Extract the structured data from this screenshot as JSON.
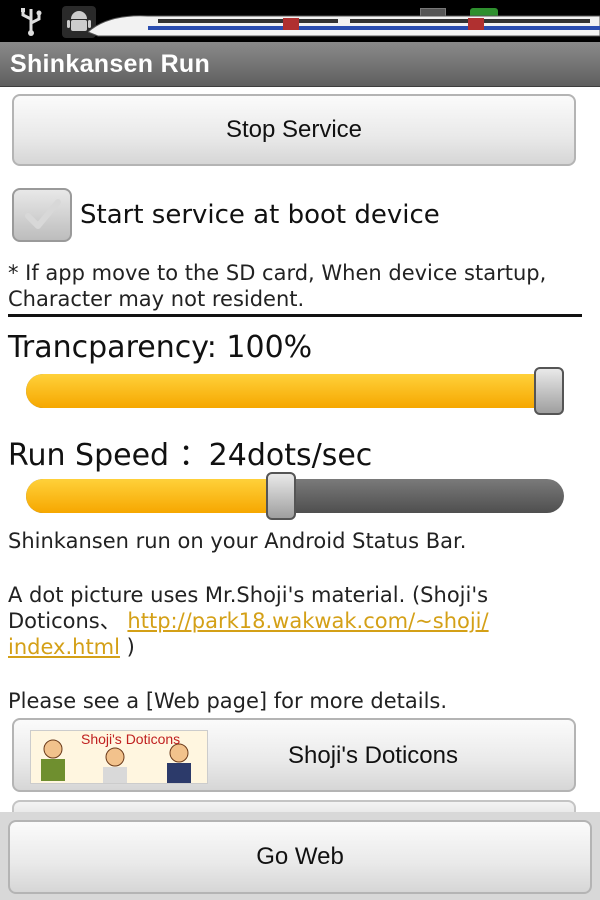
{
  "status_bar": {
    "icons": [
      "usb-icon",
      "android-debug-icon",
      "shinkansen-train-icon",
      "sd-card-icon",
      "battery-icon"
    ]
  },
  "title_bar": {
    "title": "Shinkansen Run"
  },
  "service": {
    "stop_label": "Stop Service"
  },
  "boot": {
    "checkbox_label": "Start service at boot device",
    "checked": true,
    "note": "* If app move to the SD card, When device startup, Character may not resident."
  },
  "transparency": {
    "label": "Trancparency: 100%",
    "value_percent": 100
  },
  "run_speed": {
    "label": "Run Speed ：24dots/sec",
    "value_fraction": 0.47
  },
  "info": {
    "description": "Shinkansen run on your Android Status Bar.",
    "credit_prefix": "A dot picture uses Mr.Shoji's material. (Shoji's Doticons、",
    "credit_link_part1": "http://park18.wakwak.com/~shoji/",
    "credit_link_part2": "index.html",
    "credit_suffix": " )",
    "web_note": "Please see a [Web page] for more details."
  },
  "doticons": {
    "label": "Shoji's Doticons",
    "image_caption": "Shoji's Doticons"
  },
  "footer": {
    "go_web_label": "Go Web"
  },
  "colors": {
    "accent": "#f6b400",
    "link": "#d4a017",
    "title_bar": "#6e6e6e"
  }
}
